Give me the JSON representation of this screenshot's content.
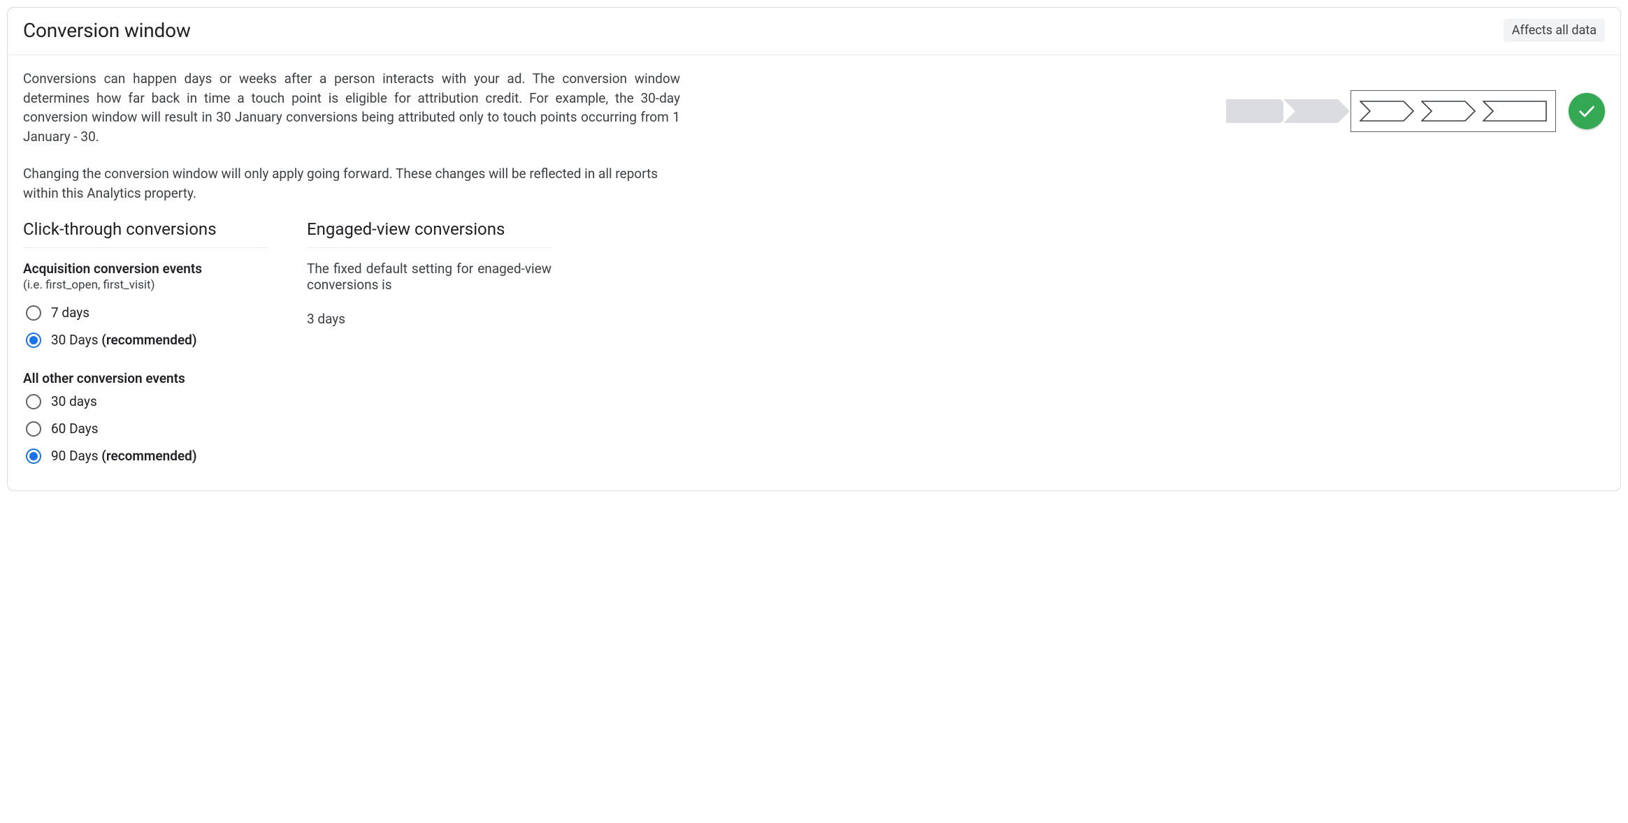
{
  "header": {
    "title": "Conversion window",
    "badge": "Affects all data"
  },
  "description": {
    "p1": "Conversions can happen days or weeks after a person interacts with your ad. The conversion window determines how far back in time a touch point is eligible for attribution credit. For example, the 30-day conversion window will result in 30 January conversions being attributed only to touch points occurring from 1 January - 30.",
    "p2": "Changing the conversion window will only apply going forward. These changes will be reflected in all reports within this Analytics property."
  },
  "click_through": {
    "title": "Click-through conversions",
    "groups": [
      {
        "title": "Acquisition conversion events",
        "subtitle": "(i.e. first_open, first_visit)",
        "options": [
          {
            "label": "7 days",
            "recommended": "",
            "selected": false
          },
          {
            "label": "30 Days ",
            "recommended": "(recommended)",
            "selected": true
          }
        ]
      },
      {
        "title": "All other conversion events",
        "subtitle": "",
        "options": [
          {
            "label": "30 days",
            "recommended": "",
            "selected": false
          },
          {
            "label": "60 Days",
            "recommended": "",
            "selected": false
          },
          {
            "label": "90 Days ",
            "recommended": "(recommended)",
            "selected": true
          }
        ]
      }
    ]
  },
  "engaged_view": {
    "title": "Engaged-view conversions",
    "desc": "The fixed default setting for enaged-view conversions is",
    "value": "3 days"
  },
  "icons": {
    "check": "check-icon"
  }
}
